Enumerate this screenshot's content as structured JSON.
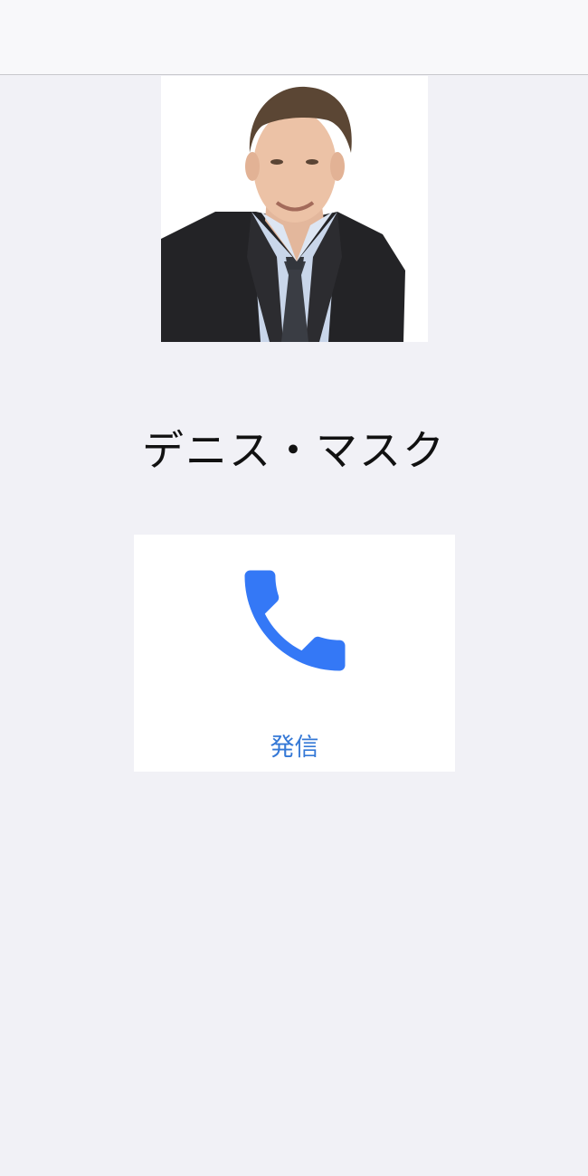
{
  "contact": {
    "name": "デニス・マスク"
  },
  "call_action": {
    "label": "発信",
    "icon": "phone-icon",
    "color": "#3478f6"
  },
  "colors": {
    "background": "#f1f1f6",
    "card": "#ffffff",
    "top_bar": "#f8f8fa"
  }
}
